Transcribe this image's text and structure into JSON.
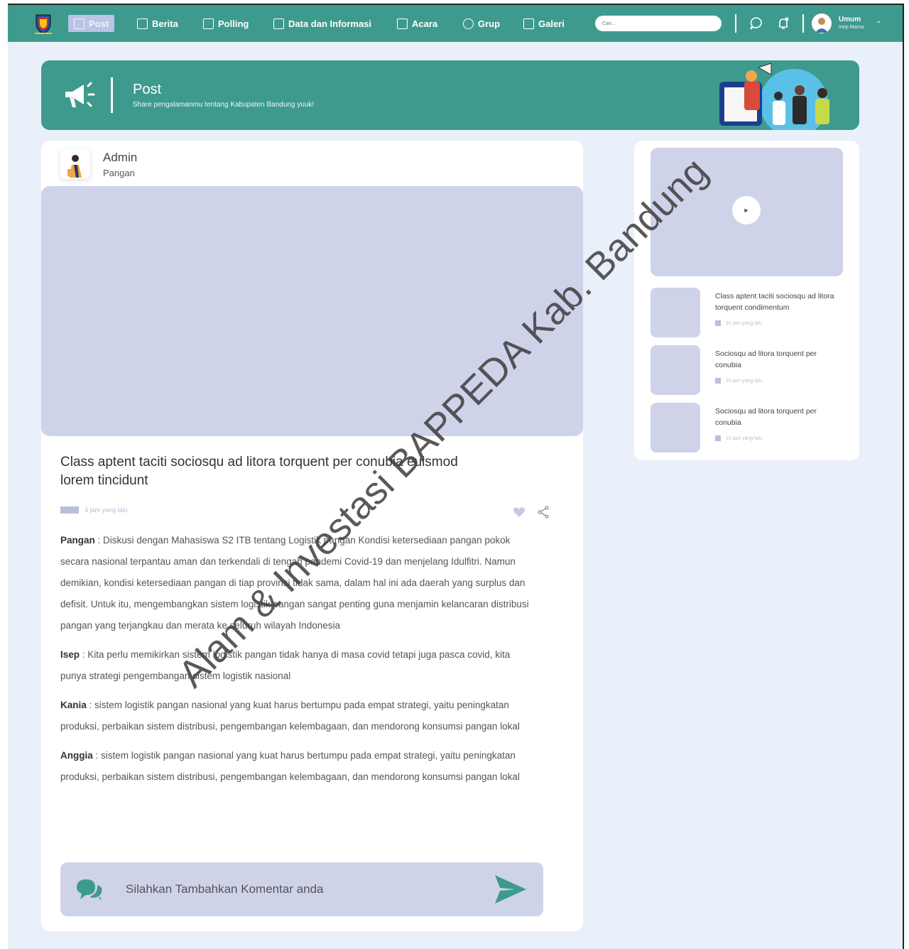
{
  "nav": {
    "items": [
      {
        "label": "Post",
        "icon": "post-add-icon"
      },
      {
        "label": "Berita",
        "icon": "news-icon"
      },
      {
        "label": "Polling",
        "icon": "poll-chart-icon"
      },
      {
        "label": "Data dan Informasi",
        "icon": "data-list-icon"
      },
      {
        "label": "Acara",
        "icon": "calendar-icon"
      },
      {
        "label": "Grup",
        "icon": "group-icon"
      },
      {
        "label": "Galeri",
        "icon": "gallery-icon"
      }
    ],
    "search_placeholder": "Cari...",
    "user_name": "Umum",
    "user_sub": "Inep Marna"
  },
  "banner": {
    "title": "Post",
    "subtitle": "Share pengalamanmu tentang Kabupaten Bandung yuuk!"
  },
  "post": {
    "author": "Admin",
    "category": "Pangan",
    "title": "Class aptent taciti sociosqu ad litora torquent per conubia euismod lorem tincidunt",
    "time": "4 jam yang lalu",
    "paragraphs": [
      {
        "speaker": "Pangan",
        "text": " : Diskusi dengan Mahasiswa S2 ITB tentang Logistik pangan Kondisi ketersediaan pangan pokok secara nasional terpantau aman dan terkendali di tengah pandemi Covid-19 dan menjelang Idulfitri. Namun demikian, kondisi ketersediaan pangan di tiap provinsi tidak sama, dalam hal ini ada daerah yang surplus dan defisit. Untuk itu, mengembangkan sistem logistik pangan sangat penting guna menjamin kelancaran distribusi pangan yang terjangkau dan merata ke seluruh wilayah Indonesia"
      },
      {
        "speaker": "Isep",
        "text": " : Kita perlu memikirkan sistem logistik pangan tidak hanya di masa covid tetapi juga pasca covid, kita punya strategi pengembangan sistem logistik nasional"
      },
      {
        "speaker": "Kania",
        "text": " : sistem logistik pangan nasional yang kuat harus bertumpu pada empat strategi, yaitu peningkatan produksi, perbaikan sistem distribusi, pengembangan kelembagaan, dan mendorong konsumsi pangan lokal"
      },
      {
        "speaker": "Anggia",
        "text": " : sistem logistik pangan nasional yang kuat harus bertumpu pada empat strategi, yaitu peningkatan produksi, perbaikan sistem distribusi, pengembangan kelembagaan, dan mendorong konsumsi pangan lokal"
      }
    ]
  },
  "comment": {
    "placeholder": "Silahkan Tambahkan Komentar anda"
  },
  "sidebar": {
    "items": [
      {
        "title": "Class aptent taciti sociosqu ad litora torquent condimentum",
        "time": "10 jam yang lalu"
      },
      {
        "title": "Sociosqu ad litora torquent per conubia",
        "time": "10 jam yang lalu"
      },
      {
        "title": "Sociosqu ad litora torquent per conubia",
        "time": "10 jam yang lalu"
      }
    ]
  },
  "watermark": "Alam & Investasi BAPPEDA Kab. Bandung",
  "colors": {
    "primary": "#3f9a8e",
    "placeholder": "#cfd3ea",
    "background": "#eaf0f9",
    "active_nav": "#b9c4e6"
  }
}
